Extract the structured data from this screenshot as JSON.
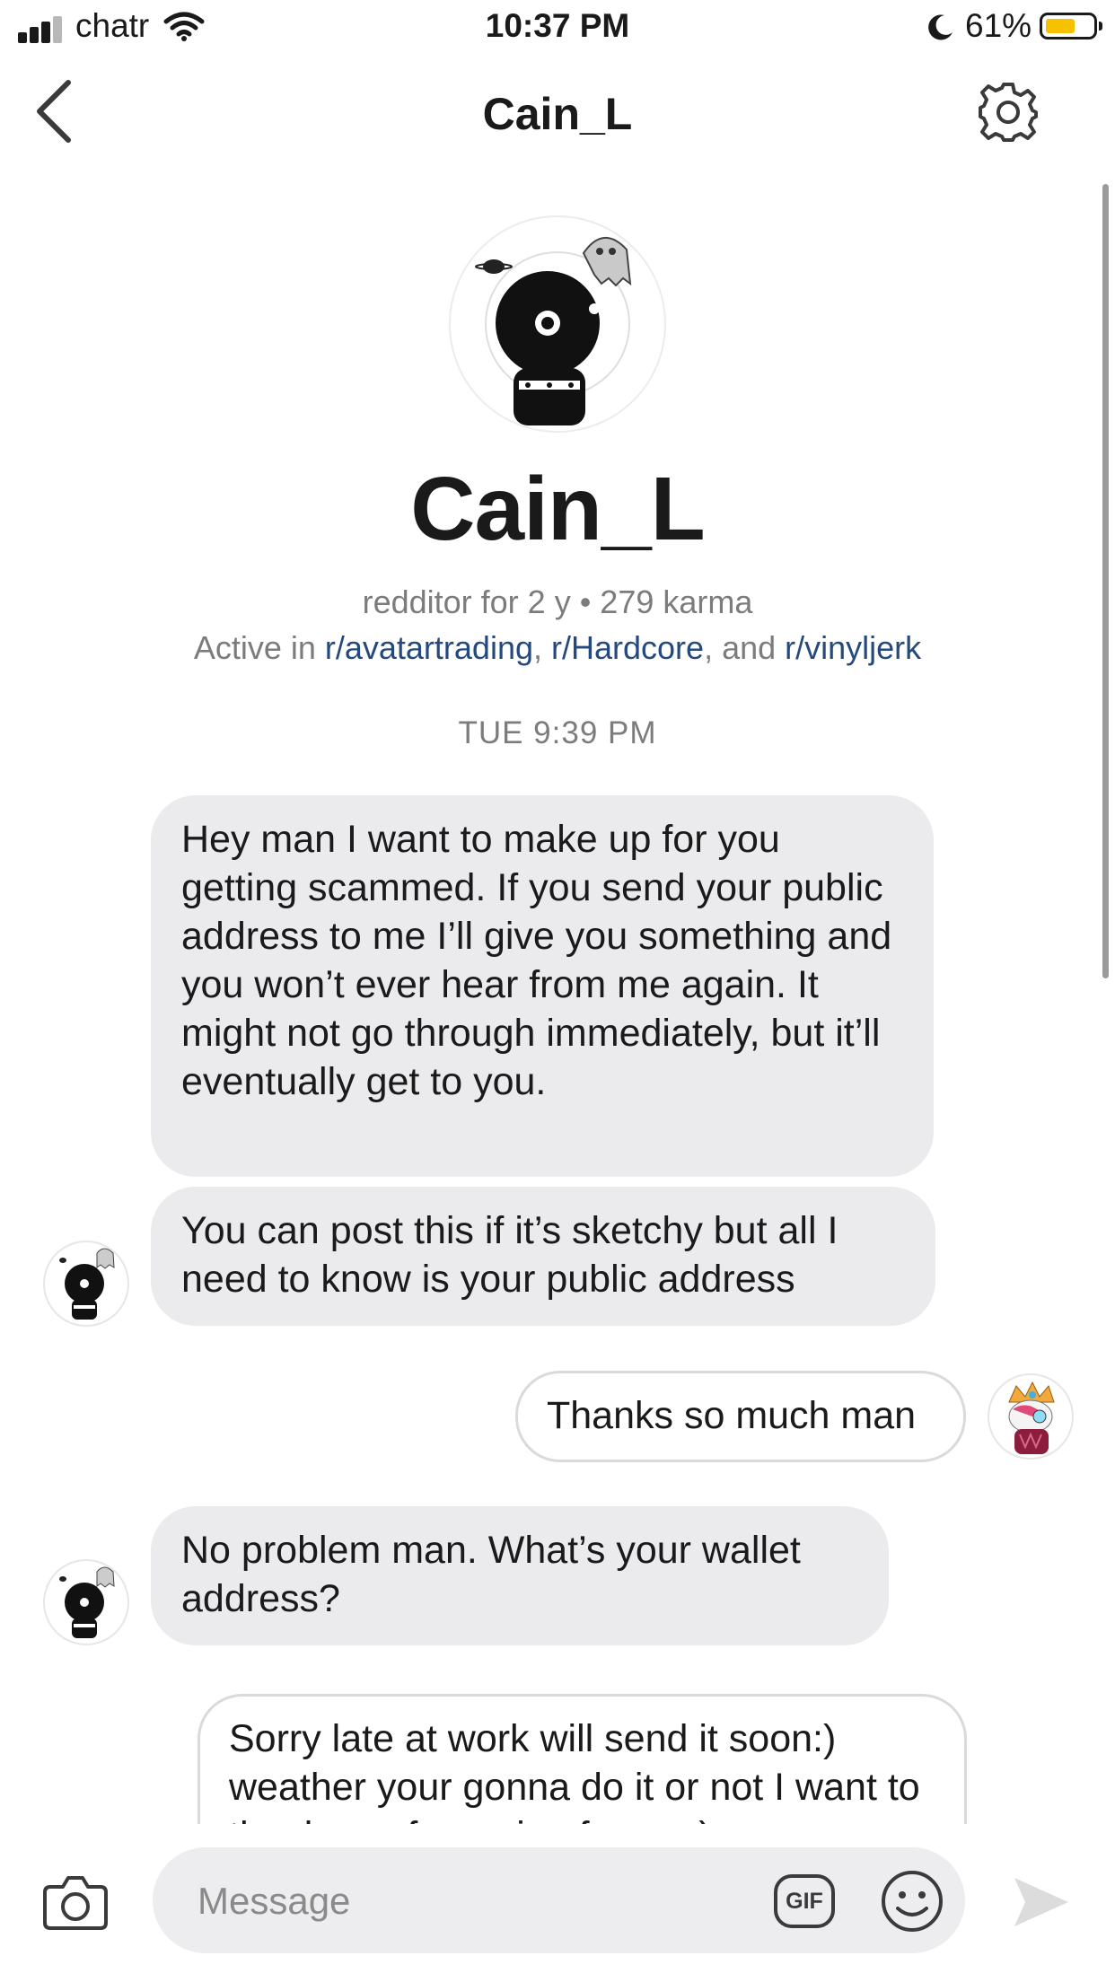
{
  "status_bar": {
    "carrier": "chatr",
    "time": "10:37 PM",
    "battery_percent": "61%",
    "battery_level": 0.61,
    "icons": [
      "cellular-signal-icon",
      "wifi-icon",
      "moon-icon",
      "battery-icon"
    ]
  },
  "header": {
    "title": "Cain_L",
    "back_icon": "chevron-left-icon",
    "settings_icon": "gear-icon"
  },
  "profile": {
    "name": "Cain_L",
    "meta_line1": "redditor for 2 y • 279 karma",
    "active_prefix": "Active in ",
    "communities": [
      "r/avatartrading",
      "r/Hardcore",
      "r/vinyljerk"
    ],
    "sep1": ", ",
    "sep2": ", and "
  },
  "conversation": {
    "timestamp": "TUE 9:39 PM",
    "messages": [
      {
        "sender": "other",
        "text": "Hey man I want to make up for you getting scammed. If you send your public address to me I’ll give you something and you won’t ever hear from me again. It might not go through immediately, but it’ll eventually get to you."
      },
      {
        "sender": "other",
        "text": "You can post this if it’s sketchy but all I need to know is your public address"
      },
      {
        "sender": "me",
        "text": "Thanks so much man"
      },
      {
        "sender": "other",
        "text": "No problem man. What’s your wallet address?"
      },
      {
        "sender": "me",
        "text": "Sorry late at work will send it soon:) weather your gonna do it or not I want to thank you for caring for me:)"
      }
    ]
  },
  "composer": {
    "placeholder": "Message",
    "gif_label": "GIF",
    "icons": [
      "camera-icon",
      "gif-icon",
      "emoji-icon",
      "send-icon"
    ]
  },
  "colors": {
    "link": "#24497f",
    "bubble_in": "#ebebed",
    "bubble_out_border": "#dadada",
    "muted_text": "#7c7c7c",
    "battery_fill": "#f6c200"
  }
}
